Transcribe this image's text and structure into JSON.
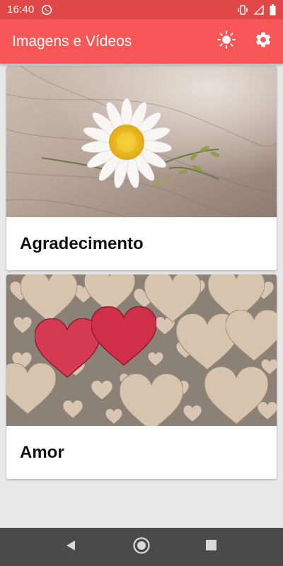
{
  "status_bar": {
    "time": "16:40",
    "icons": [
      "whatsapp-icon",
      "vibrate-icon",
      "signal-icon",
      "battery-icon"
    ]
  },
  "app_bar": {
    "title": "Imagens e Vídeos",
    "actions": [
      "brightness-icon",
      "settings-icon"
    ]
  },
  "categories": [
    {
      "label": "Agradecimento",
      "image": "daisy-on-wood-photo"
    },
    {
      "label": "Amor",
      "image": "wooden-hearts-photo"
    }
  ],
  "nav_bar": {
    "buttons": [
      "back-icon",
      "home-icon",
      "recents-icon"
    ]
  },
  "colors": {
    "status_bar": "#e04848",
    "app_bar": "#f95757",
    "background": "#e8e8e8",
    "nav_bar": "#4a4a4a"
  }
}
